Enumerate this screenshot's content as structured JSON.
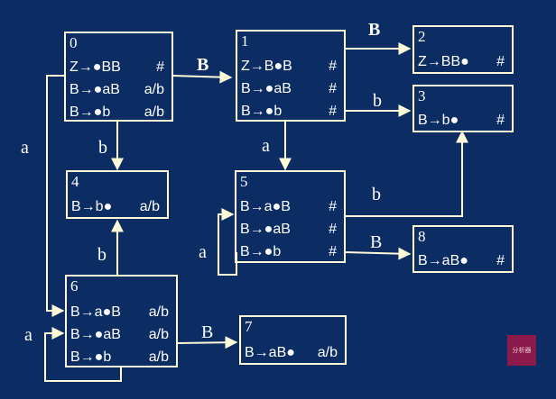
{
  "colors": {
    "background": "#0b2d63",
    "line": "#fffbd8",
    "text": "#ffffff"
  },
  "states": [
    {
      "num": "0",
      "items": [
        {
          "prod": "Z→●BB",
          "look": "#"
        },
        {
          "prod": "B→●aB",
          "look": "a/b"
        },
        {
          "prod": "B→●b",
          "look": "a/b"
        }
      ]
    },
    {
      "num": "1",
      "items": [
        {
          "prod": "Z→B●B",
          "look": "#"
        },
        {
          "prod": "B→●aB",
          "look": "#"
        },
        {
          "prod": "B→●b",
          "look": "#"
        }
      ]
    },
    {
      "num": "2",
      "items": [
        {
          "prod": "Z→BB●",
          "look": "#"
        }
      ]
    },
    {
      "num": "3",
      "items": [
        {
          "prod": "B→b●",
          "look": "#"
        }
      ]
    },
    {
      "num": "4",
      "items": [
        {
          "prod": "B→b●",
          "look": "a/b"
        }
      ]
    },
    {
      "num": "5",
      "items": [
        {
          "prod": "B→a●B",
          "look": "#"
        },
        {
          "prod": "B→●aB",
          "look": "#"
        },
        {
          "prod": "B→●b",
          "look": "#"
        }
      ]
    },
    {
      "num": "6",
      "items": [
        {
          "prod": "B→a●B",
          "look": "a/b"
        },
        {
          "prod": "B→●aB",
          "look": "a/b"
        },
        {
          "prod": "B→●b",
          "look": "a/b"
        }
      ]
    },
    {
      "num": "7",
      "items": [
        {
          "prod": "B→aB●",
          "look": "a/b"
        }
      ]
    },
    {
      "num": "8",
      "items": [
        {
          "prod": "B→aB●",
          "look": "#"
        }
      ]
    }
  ],
  "edge_labels": {
    "e0_1": "B",
    "e1_2": "B",
    "e1_3": "b",
    "e1_5": "a",
    "e0_4": "b",
    "e0_6": "a",
    "e5_3": "b",
    "e5_8": "B",
    "e5_5": "a",
    "e6_4": "b",
    "e6_7": "B",
    "e6_6": "a"
  },
  "badge": "分析器"
}
